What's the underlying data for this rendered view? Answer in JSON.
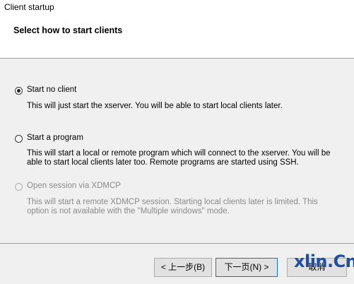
{
  "window": {
    "title": "Client startup"
  },
  "header": {
    "heading": "Select how to start clients"
  },
  "options": [
    {
      "label": "Start no client",
      "description": "This will just start the xserver. You will be able to start local clients later.",
      "checked": true,
      "enabled": true
    },
    {
      "label": "Start a program",
      "description": "This will start a local or remote program which will connect to the xserver. You will be able to start local clients later too. Remote programs are started using SSH.",
      "checked": false,
      "enabled": true
    },
    {
      "label": "Open session via XDMCP",
      "description": "This will start a remote XDMCP session. Starting local clients later is limited. This option is not available with the \"Multiple windows\" mode.",
      "checked": false,
      "enabled": false
    }
  ],
  "buttons": {
    "back_label": "< 上一步(B)",
    "next_label": "下一页(N) >",
    "cancel_label": "取消"
  },
  "watermark": "xlin.Cn"
}
